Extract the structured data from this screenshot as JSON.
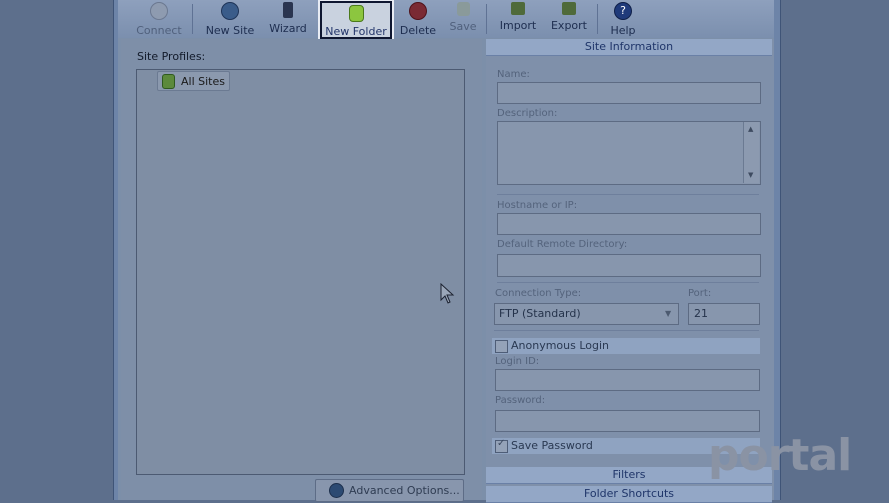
{
  "toolbar": {
    "connect": "Connect",
    "new_site": "New Site",
    "wizard": "Wizard",
    "new_folder": "New Folder",
    "delete": "Delete",
    "save": "Save",
    "import": "Import",
    "export": "Export",
    "help": "Help"
  },
  "left": {
    "profiles_label": "Site Profiles:",
    "tree_root": "All Sites",
    "advanced_button": "Advanced Options..."
  },
  "right": {
    "site_info_header": "Site Information",
    "name_label": "Name:",
    "name_value": "",
    "description_label": "Description:",
    "description_value": "",
    "hostname_label": "Hostname or IP:",
    "hostname_value": "",
    "remote_dir_label": "Default Remote Directory:",
    "remote_dir_value": "",
    "connection_type_label": "Connection Type:",
    "connection_type_value": "FTP (Standard)",
    "port_label": "Port:",
    "port_value": "21",
    "anonymous_label": "Anonymous Login",
    "anonymous_checked": false,
    "login_id_label": "Login ID:",
    "login_id_value": "",
    "password_label": "Password:",
    "password_value": "",
    "save_password_label": "Save Password",
    "save_password_checked": true,
    "filters_header": "Filters",
    "shortcuts_header": "Folder Shortcuts"
  },
  "watermark": {
    "main": "portal",
    "sub": ""
  },
  "colors": {
    "background": "#5d6f8c",
    "header_text": "#1f3569",
    "highlight_border": "#0e1630",
    "toolbar_text": "#1d2d4f"
  }
}
